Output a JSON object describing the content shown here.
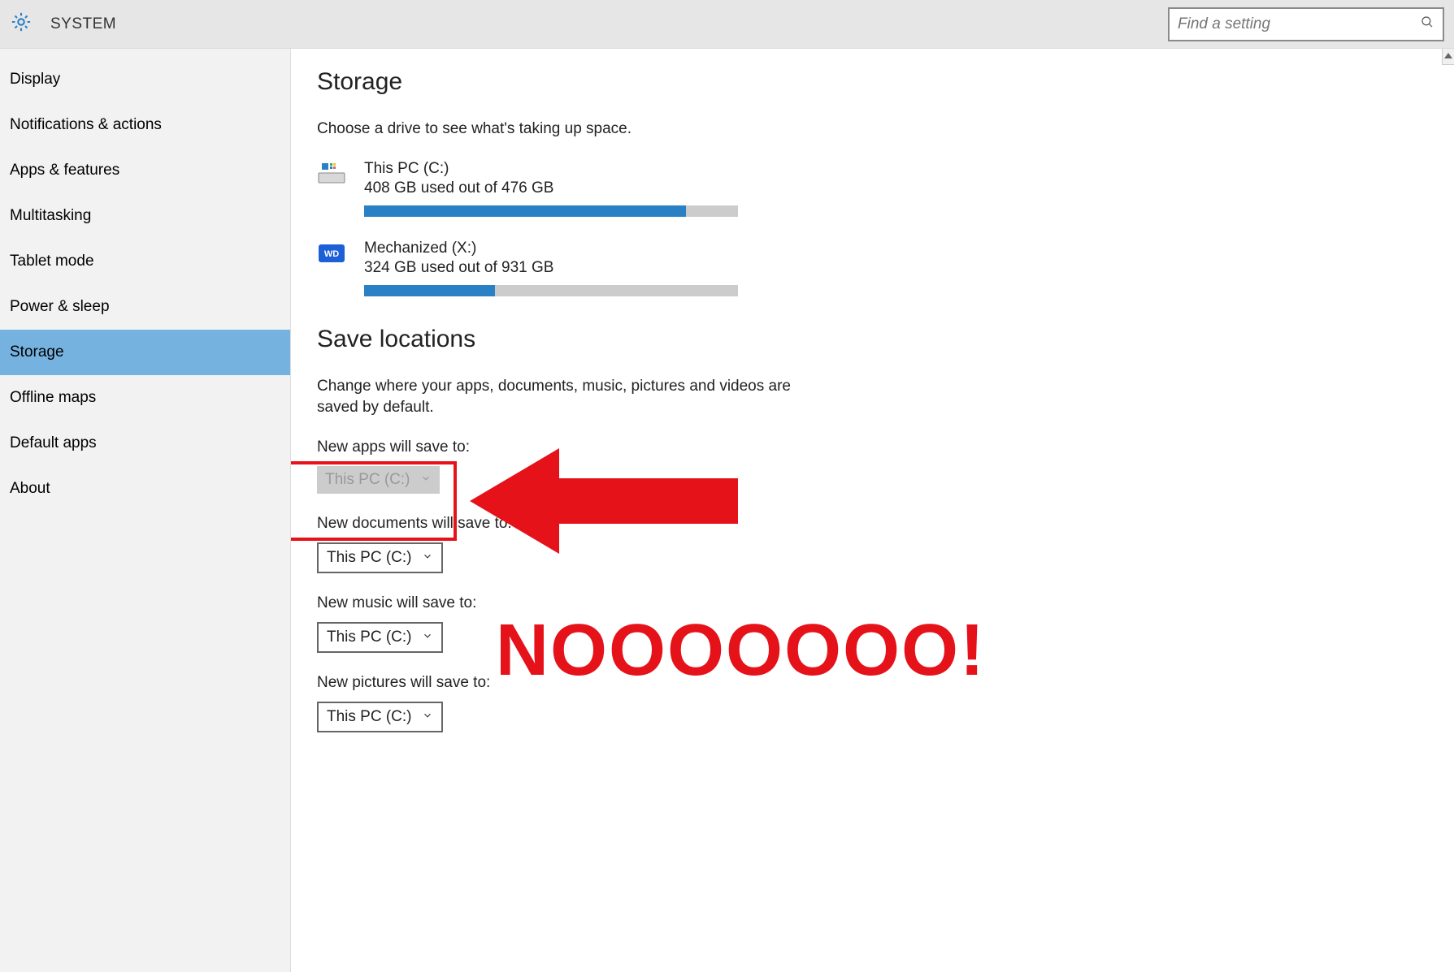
{
  "header": {
    "title": "SYSTEM",
    "search_placeholder": "Find a setting"
  },
  "sidebar": {
    "items": [
      {
        "label": "Display"
      },
      {
        "label": "Notifications & actions"
      },
      {
        "label": "Apps & features"
      },
      {
        "label": "Multitasking"
      },
      {
        "label": "Tablet mode"
      },
      {
        "label": "Power & sleep"
      },
      {
        "label": "Storage",
        "selected": true
      },
      {
        "label": "Offline maps"
      },
      {
        "label": "Default apps"
      },
      {
        "label": "About"
      }
    ]
  },
  "storage": {
    "heading": "Storage",
    "subtitle": "Choose a drive to see what's taking up space.",
    "drives": [
      {
        "name": "This PC (C:)",
        "usage_text": "408 GB used out of 476 GB",
        "fill_pct": 86,
        "icon": "local-disk"
      },
      {
        "name": "Mechanized (X:)",
        "usage_text": "324 GB used out of 931 GB",
        "fill_pct": 35,
        "icon": "wd-disk"
      }
    ]
  },
  "save_locations": {
    "heading": "Save locations",
    "description": "Change where your apps, documents, music, pictures and videos are saved by default.",
    "items": [
      {
        "label": "New apps will save to:",
        "value": "This PC (C:)",
        "disabled": true
      },
      {
        "label": "New documents will save to:",
        "value": "This PC (C:)",
        "disabled": false
      },
      {
        "label": "New music will save to:",
        "value": "This PC (C:)",
        "disabled": false
      },
      {
        "label": "New pictures will save to:",
        "value": "This PC (C:)",
        "disabled": false
      }
    ]
  },
  "annotation": {
    "text": "NOOOOOOO!",
    "color": "#e5121a"
  }
}
